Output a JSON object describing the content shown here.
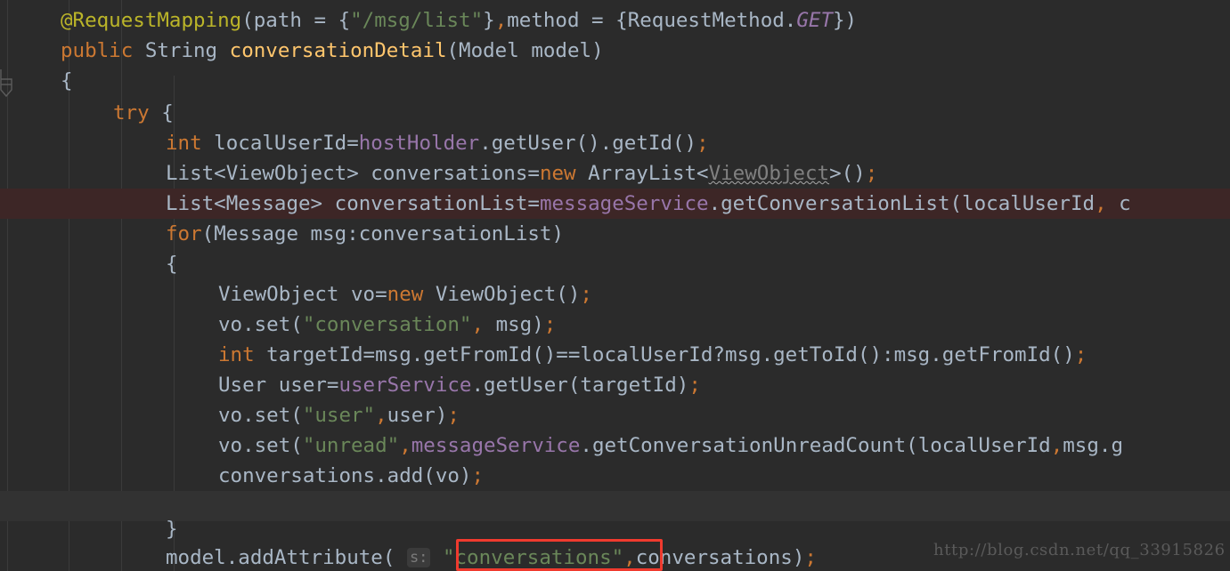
{
  "editor": {
    "background_color": "#2b2b2b",
    "error_line_color": "#3d2626",
    "band_line_color": "#323232",
    "highlight_box_color": "#f03a2e",
    "font_size_px": 22.5,
    "line_height_px": 34
  },
  "watermark": {
    "text": "http://blog.csdn.net/qq_33915826"
  },
  "hints": {
    "addattribute_param": "s:"
  },
  "code": {
    "language": "java",
    "lines": [
      {
        "index": 0,
        "indent": 0,
        "text": "@RequestMapping(path = {\"/msg/list\"},method = {RequestMethod.GET})"
      },
      {
        "index": 1,
        "indent": 0,
        "text": "public String conversationDetail(Model model)"
      },
      {
        "index": 2,
        "indent": 0,
        "text": "{"
      },
      {
        "index": 3,
        "indent": 1,
        "text": "try {"
      },
      {
        "index": 4,
        "indent": 2,
        "text": "int localUserId=hostHolder.getUser().getId();"
      },
      {
        "index": 5,
        "indent": 2,
        "text": "List<ViewObject> conversations=new ArrayList<ViewObject>();"
      },
      {
        "index": 6,
        "indent": 2,
        "text": "List<Message> conversationList=messageService.getConversationList(localUserId, c"
      },
      {
        "index": 7,
        "indent": 2,
        "text": "for(Message msg:conversationList)"
      },
      {
        "index": 8,
        "indent": 2,
        "text": "{"
      },
      {
        "index": 9,
        "indent": 3,
        "text": "ViewObject vo=new ViewObject();"
      },
      {
        "index": 10,
        "indent": 3,
        "text": "vo.set(\"conversation\", msg);"
      },
      {
        "index": 11,
        "indent": 3,
        "text": "int targetId=msg.getFromId()==localUserId?msg.getToId():msg.getFromId();"
      },
      {
        "index": 12,
        "indent": 3,
        "text": "User user=userService.getUser(targetId);"
      },
      {
        "index": 13,
        "indent": 3,
        "text": "vo.set(\"user\",user);"
      },
      {
        "index": 14,
        "indent": 3,
        "text": "vo.set(\"unread\",messageService.getConversationUnreadCount(localUserId,msg.g"
      },
      {
        "index": 15,
        "indent": 3,
        "text": "conversations.add(vo);"
      },
      {
        "index": 16,
        "indent": 0,
        "text": ""
      },
      {
        "index": 17,
        "indent": 2,
        "text": "}"
      },
      {
        "index": 18,
        "indent": 2,
        "text": "model.addAttribute( s: \"conversations\",conversations);"
      }
    ],
    "error_line_index": 6,
    "band_line_index": 16,
    "highlighted_token": "\"conversations\""
  }
}
